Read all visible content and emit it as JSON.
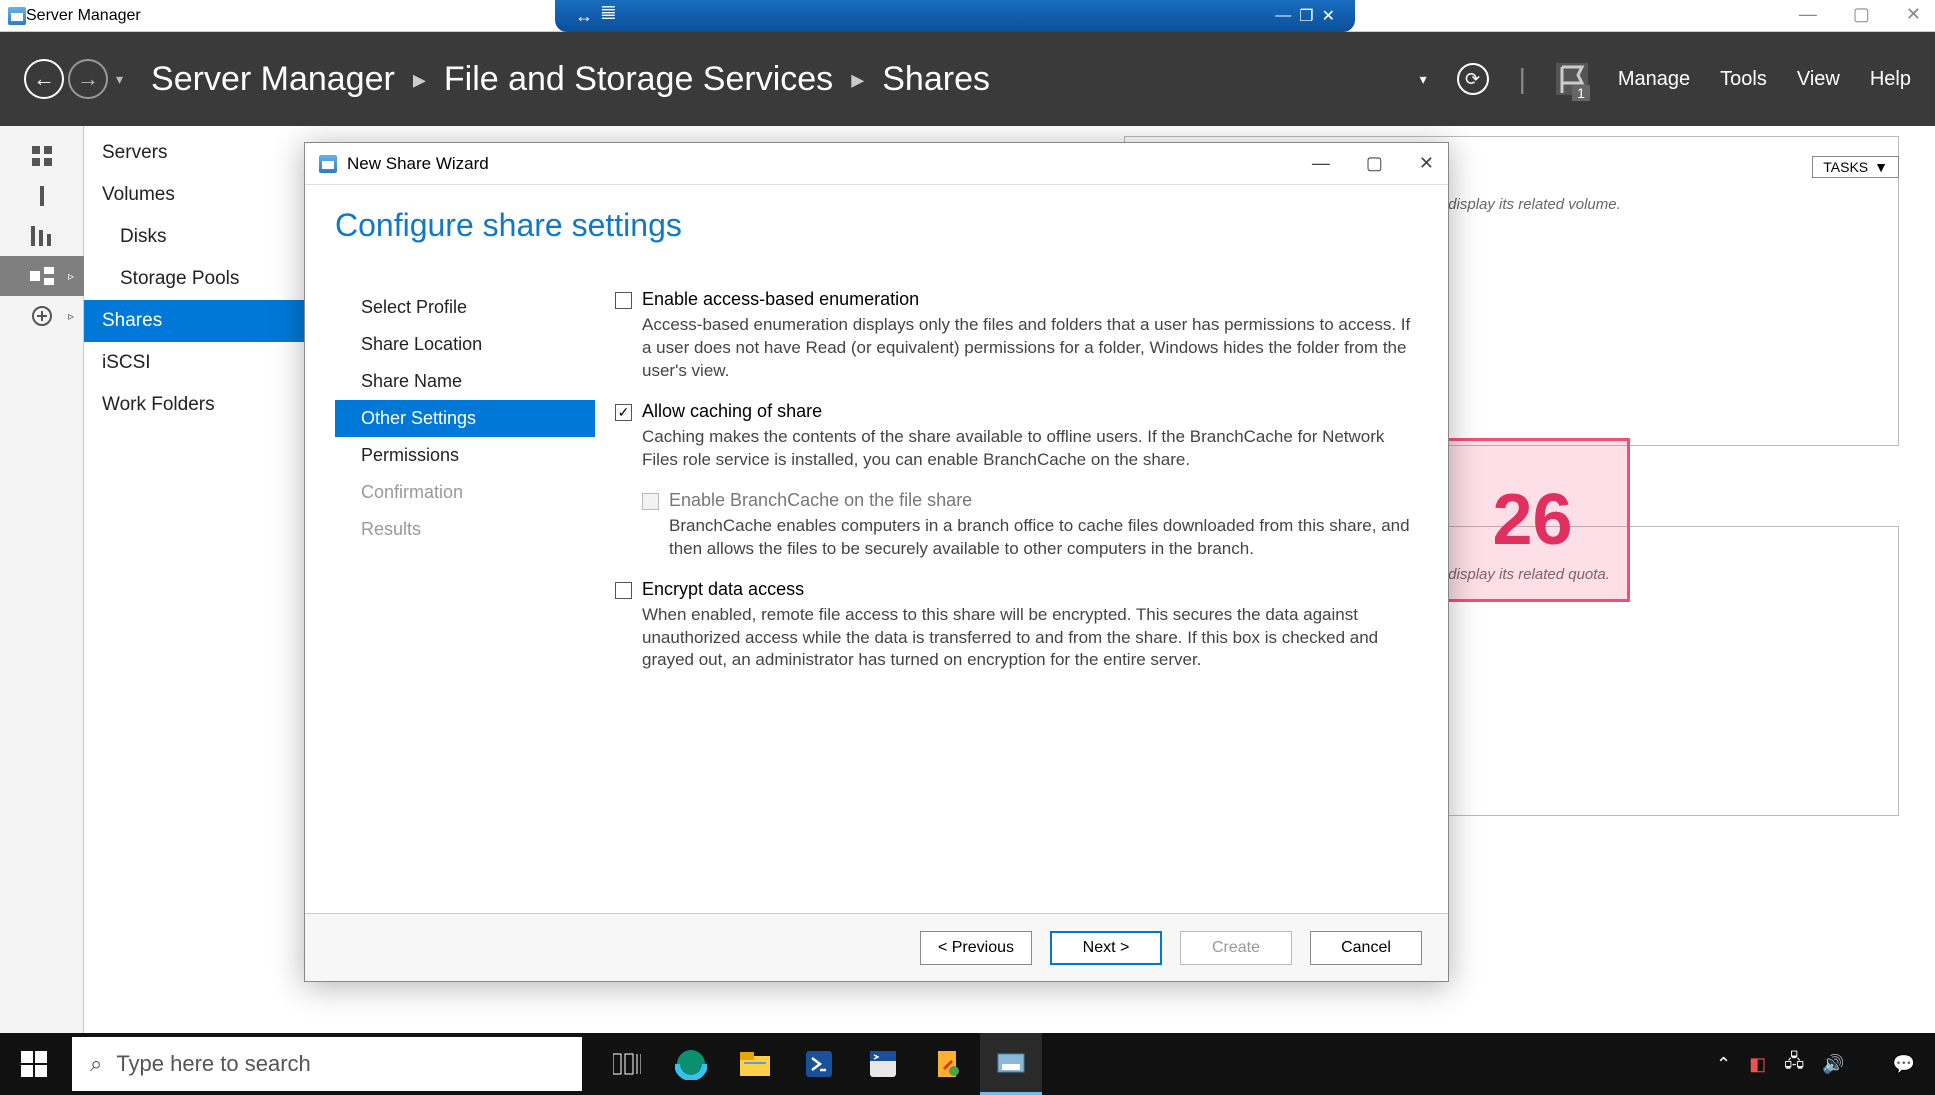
{
  "outer_window": {
    "title": "Server Manager"
  },
  "blue_tab": {
    "move_icon": "↔",
    "signal_icon": "𝍤",
    "min": "—",
    "max": "❐",
    "close": "✕"
  },
  "outer_win": {
    "min": "—",
    "max": "▢",
    "close": "✕"
  },
  "header": {
    "breadcrumbs": [
      "Server Manager",
      "File and Storage Services",
      "Shares"
    ],
    "menu": {
      "manage": "Manage",
      "tools": "Tools",
      "view": "View",
      "help": "Help"
    },
    "flag_badge": "1"
  },
  "nav": {
    "items": [
      {
        "label": "Servers",
        "indent": false,
        "sel": false
      },
      {
        "label": "Volumes",
        "indent": false,
        "sel": false
      },
      {
        "label": "Disks",
        "indent": true,
        "sel": false
      },
      {
        "label": "Storage Pools",
        "indent": true,
        "sel": false
      },
      {
        "label": "Shares",
        "indent": false,
        "sel": true
      },
      {
        "label": "iSCSI",
        "indent": false,
        "sel": false
      },
      {
        "label": "Work Folders",
        "indent": false,
        "sel": false
      }
    ]
  },
  "content": {
    "tasks": "TASKS",
    "hint_volume": "re to display its related volume.",
    "hint_quota": "re to display its related quota."
  },
  "dialog": {
    "title": "New Share Wizard",
    "heading": "Configure share settings",
    "steps": [
      {
        "label": "Select Profile",
        "state": "done"
      },
      {
        "label": "Share Location",
        "state": "done"
      },
      {
        "label": "Share Name",
        "state": "done"
      },
      {
        "label": "Other Settings",
        "state": "sel"
      },
      {
        "label": "Permissions",
        "state": "done"
      },
      {
        "label": "Confirmation",
        "state": "dis"
      },
      {
        "label": "Results",
        "state": "dis"
      }
    ],
    "opt1": {
      "label": "Enable access-based enumeration",
      "checked": false,
      "desc": "Access-based enumeration displays only the files and folders that a user has permissions to access. If a user does not have Read (or equivalent) permissions for a folder, Windows hides the folder from the user's view."
    },
    "opt2": {
      "label": "Allow caching of share",
      "checked": true,
      "desc": "Caching makes the contents of the share available to offline users. If the BranchCache for Network Files role service is installed, you can enable BranchCache on the share."
    },
    "opt2a": {
      "label": "Enable BranchCache on the file share",
      "checked": false,
      "disabled": true,
      "desc": "BranchCache enables computers in a branch office to cache files downloaded from this share, and then allows the files to be securely available to other computers in the branch."
    },
    "opt3": {
      "label": "Encrypt data access",
      "checked": false,
      "desc": "When enabled, remote file access to this share will be encrypted. This secures the data against unauthorized access while the data is transferred to and from the share. If this box is checked and grayed out, an administrator has turned on encryption for the entire server."
    },
    "buttons": {
      "prev": "< Previous",
      "next": "Next >",
      "create": "Create",
      "cancel": "Cancel"
    }
  },
  "annotation": {
    "number": "26"
  },
  "taskbar": {
    "search_placeholder": "Type here to search",
    "apps": [
      {
        "name": "task-view-icon"
      },
      {
        "name": "edge-icon"
      },
      {
        "name": "explorer-icon"
      },
      {
        "name": "powershell-icon"
      },
      {
        "name": "powershell-ise-icon"
      },
      {
        "name": "tools-icon"
      },
      {
        "name": "server-manager-icon"
      }
    ]
  }
}
